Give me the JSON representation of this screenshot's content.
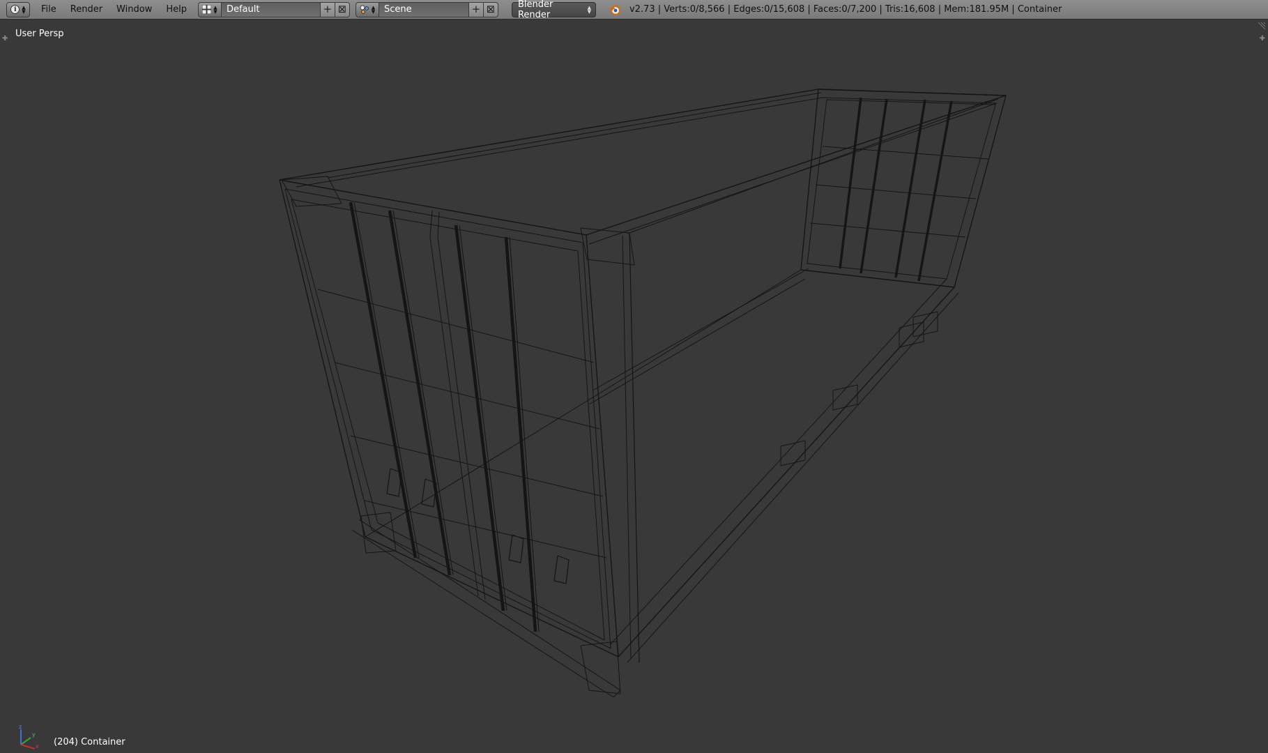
{
  "header": {
    "editor_icon": "info-icon",
    "menus": [
      "File",
      "Render",
      "Window",
      "Help"
    ],
    "screen_layout": {
      "icon": "screen-layout-icon",
      "value": "Default"
    },
    "scene": {
      "icon": "scene-icon",
      "value": "Scene"
    },
    "render_engine": "Blender Render",
    "stats": "v2.73 | Verts:0/8,566 | Edges:0/15,608 | Faces:0/7,200 | Tris:16,608 | Mem:181.95M | Container"
  },
  "viewport": {
    "view_name": "User Persp",
    "object_info": "(204) Container",
    "shading": "wireframe",
    "axes": [
      "x",
      "y",
      "z"
    ]
  },
  "colors": {
    "viewport_bg": "#393939",
    "header_bg": "#808080",
    "wire": "#151515"
  }
}
